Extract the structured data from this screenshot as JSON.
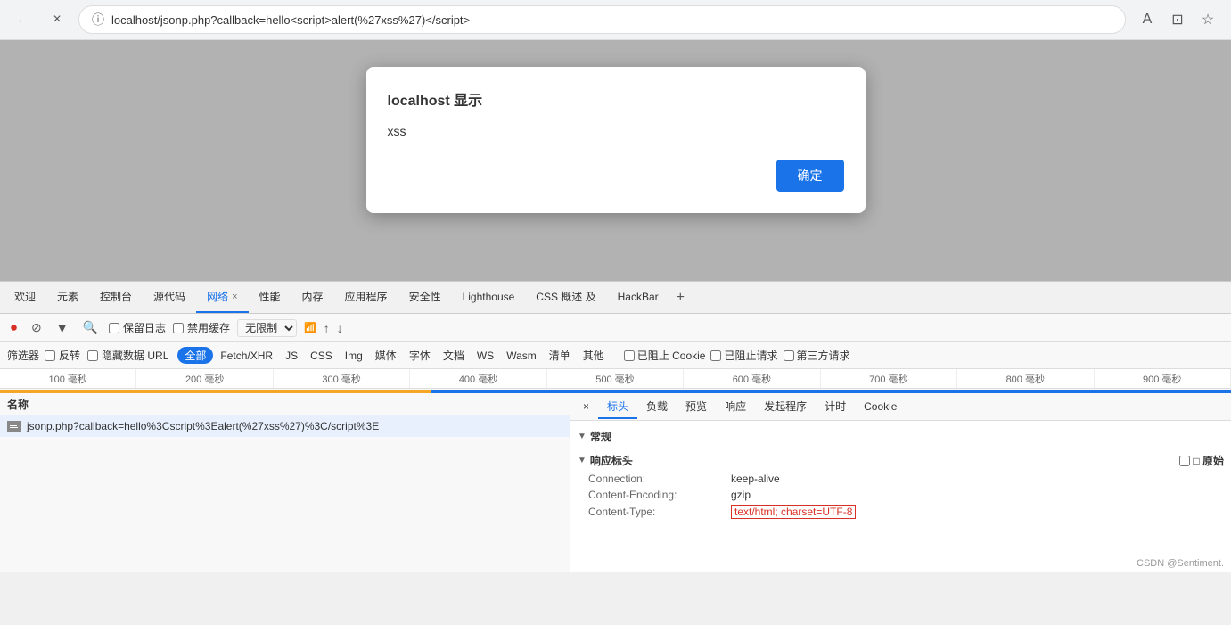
{
  "browser": {
    "back_button": "←",
    "close_button": "×",
    "info_icon": "ⓘ",
    "address": "localhost/jsonp.php?callback=hello<script>alert(%27xss%27)</script>",
    "font_size_icon": "A",
    "split_icon": "⊡",
    "bookmark_icon": "☆"
  },
  "alert": {
    "title": "localhost 显示",
    "message": "xss",
    "ok_button": "确定"
  },
  "devtools": {
    "tabs": [
      {
        "label": "欢迎",
        "active": false
      },
      {
        "label": "元素",
        "active": false
      },
      {
        "label": "控制台",
        "active": false
      },
      {
        "label": "源代码",
        "active": false
      },
      {
        "label": "网络",
        "active": true,
        "has_close": true
      },
      {
        "label": "性能",
        "active": false
      },
      {
        "label": "内存",
        "active": false
      },
      {
        "label": "应用程序",
        "active": false
      },
      {
        "label": "安全性",
        "active": false
      },
      {
        "label": "Lighthouse",
        "active": false
      },
      {
        "label": "CSS 概述",
        "active": false
      },
      {
        "label": "及",
        "active": false
      },
      {
        "label": "HackBar",
        "active": false
      }
    ],
    "add_tab": "+"
  },
  "network_toolbar": {
    "stop_btn": "⏺",
    "cancel_btn": "⊘",
    "filter_btn": "▼",
    "search_btn": "🔍",
    "preserve_log_label": "保留日志",
    "disable_cache_label": "禁用缓存",
    "throttle_label": "无限制",
    "throttle_dropdown": "▼",
    "wifi_icon": "📶",
    "upload_icon": "↑",
    "download_icon": "↓"
  },
  "filter_bar": {
    "label": "筛选器",
    "reverse_label": "反转",
    "hide_data_url_label": "隐藏数据 URL",
    "all_label": "全部",
    "types": [
      "Fetch/XHR",
      "JS",
      "CSS",
      "Img",
      "媒体",
      "字体",
      "文档",
      "WS",
      "Wasm",
      "清单",
      "其他"
    ],
    "blocked_cookies_label": "已阻止 Cookie",
    "blocked_requests_label": "已阻止请求",
    "third_party_label": "第三方请求"
  },
  "timeline": {
    "segments": [
      "100 毫秒",
      "200 毫秒",
      "300 毫秒",
      "400 毫秒",
      "500 毫秒",
      "600 毫秒",
      "700 毫秒",
      "800 毫秒",
      "900 毫秒"
    ]
  },
  "file_list": {
    "header": "名称",
    "items": [
      {
        "name": "jsonp.php?callback=hello%3Cscript%3Ealert(%27xss%27)%3C/script%3E"
      }
    ]
  },
  "detail_panel": {
    "tabs": [
      {
        "label": "×",
        "is_close": true
      },
      {
        "label": "标头",
        "active": true
      },
      {
        "label": "负载"
      },
      {
        "label": "预览"
      },
      {
        "label": "响应"
      },
      {
        "label": "发起程序"
      },
      {
        "label": "计时"
      },
      {
        "label": "Cookie"
      }
    ],
    "sections": {
      "general": {
        "header": "▼ 常规"
      },
      "response_headers": {
        "header": "▼ 响应标头",
        "raw_label": "□ 原始",
        "rows": [
          {
            "key": "Connection:",
            "value": "keep-alive"
          },
          {
            "key": "Content-Encoding:",
            "value": "gzip"
          },
          {
            "key": "Content-Type:",
            "value": "text/html; charset=UTF-8",
            "highlighted": true
          }
        ]
      }
    }
  },
  "watermark": "CSDN @Sentiment."
}
